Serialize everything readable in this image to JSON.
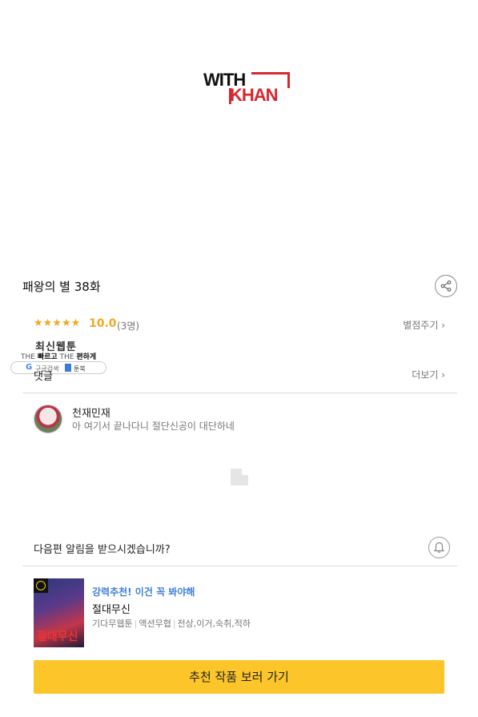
{
  "brand": {
    "logo_top": "WITH",
    "logo_bottom": "KHAN"
  },
  "episode": {
    "title": "패왕의 별 38화"
  },
  "rating": {
    "stars": "★★★★★",
    "score": "10.0",
    "count": "(3명)",
    "rate_link": "별점주기 ›"
  },
  "badge": {
    "title": "최신웹툰",
    "sub_1": "THE",
    "sub_1b": "빠르고",
    "sub_2": "THE",
    "sub_2b": "편하게",
    "google_label": "구글검색",
    "book_label": "툰북"
  },
  "comments": {
    "label": "댓글",
    "more_link": "더보기 ›",
    "items": [
      {
        "author": "천재민재",
        "text": "아 여기서 끝나다니 절단신공이 대단하네"
      }
    ]
  },
  "notify": {
    "question": "다음편 알림을 받으시겠습니까?"
  },
  "recommend": {
    "tag": "강력추천! 이건 꼭 봐야해",
    "title": "절대무신",
    "meta": [
      "기다무웹툰",
      "액션무협",
      "전상,이거,숙취,적하"
    ],
    "thumb_text": "절대무신",
    "cta": "추천 작품 보러 가기"
  },
  "colors": {
    "accent": "#fcc62a",
    "star": "#f5a623",
    "brand_red": "#d7282f",
    "tag_blue": "#3f7fd6"
  }
}
